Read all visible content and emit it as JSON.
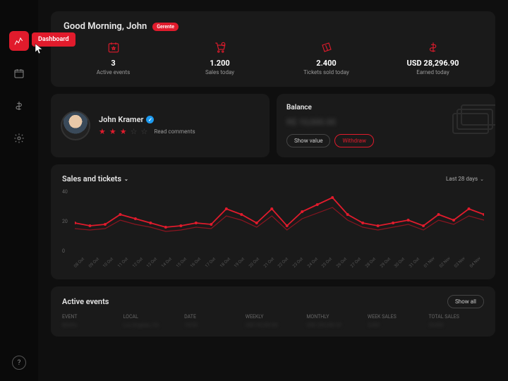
{
  "sidebar": {
    "items": [
      {
        "name": "dashboard",
        "label": "Dashboard"
      },
      {
        "name": "calendar"
      },
      {
        "name": "finance"
      },
      {
        "name": "settings"
      }
    ],
    "help": "?"
  },
  "hero": {
    "greeting": "Good Morning, John",
    "pill": "Gerente",
    "stats": [
      {
        "value": "3",
        "label": "Active events"
      },
      {
        "value": "1.200",
        "label": "Sales today"
      },
      {
        "value": "2.400",
        "label": "Tickets sold today"
      },
      {
        "value": "USD 28,296.90",
        "label": "Earned today"
      }
    ]
  },
  "profile": {
    "name": "John Kramer",
    "rating": 3,
    "read_comments": "Read comments"
  },
  "balance": {
    "title": "Balance",
    "hidden_value": "R$ 10,000.00",
    "show": "Show value",
    "withdraw": "Withdraw"
  },
  "chart": {
    "title": "Sales and tickets",
    "range": "Last 28 days",
    "y_ticks": [
      "40",
      "20",
      "0"
    ]
  },
  "events": {
    "title": "Active events",
    "show_all": "Show all",
    "columns": [
      "EVENT",
      "LOCAL",
      "DATE",
      "WEEKLY",
      "MONTHLY",
      "WEEK SALES",
      "TOTAL SALES"
    ],
    "row": [
      "Misfits",
      "Los Angeles, CA",
      "10/05",
      "USD 90,280.80",
      "USD 200,280.00",
      "5,000",
      "20,000"
    ]
  },
  "chart_data": {
    "type": "line",
    "title": "Sales and tickets",
    "xlabel": "",
    "ylabel": "",
    "ylim": [
      0,
      45
    ],
    "categories": [
      "08 Out",
      "09 Out",
      "10 Out",
      "11 Out",
      "12 Out",
      "13 Out",
      "14 Out",
      "15 Out",
      "16 Out",
      "17 Out",
      "18 Out",
      "19 Out",
      "20 Out",
      "21 Out",
      "22 Out",
      "23 Out",
      "24 Out",
      "25 Out",
      "26 Out",
      "27 Out",
      "28 Out",
      "29 Out",
      "30 Out",
      "31 Out",
      "01 Nov",
      "02 Nov",
      "03 Nov",
      "04 Nov"
    ],
    "series": [
      {
        "name": "Sales",
        "values": [
          22,
          20,
          21,
          28,
          25,
          22,
          19,
          20,
          22,
          21,
          32,
          28,
          22,
          32,
          20,
          30,
          35,
          40,
          28,
          22,
          20,
          22,
          24,
          20,
          28,
          24,
          32,
          28
        ]
      },
      {
        "name": "Tickets",
        "values": [
          18,
          17,
          18,
          24,
          21,
          19,
          16,
          17,
          19,
          18,
          27,
          24,
          19,
          27,
          17,
          25,
          29,
          33,
          24,
          19,
          17,
          19,
          21,
          17,
          24,
          21,
          27,
          24
        ]
      }
    ]
  }
}
